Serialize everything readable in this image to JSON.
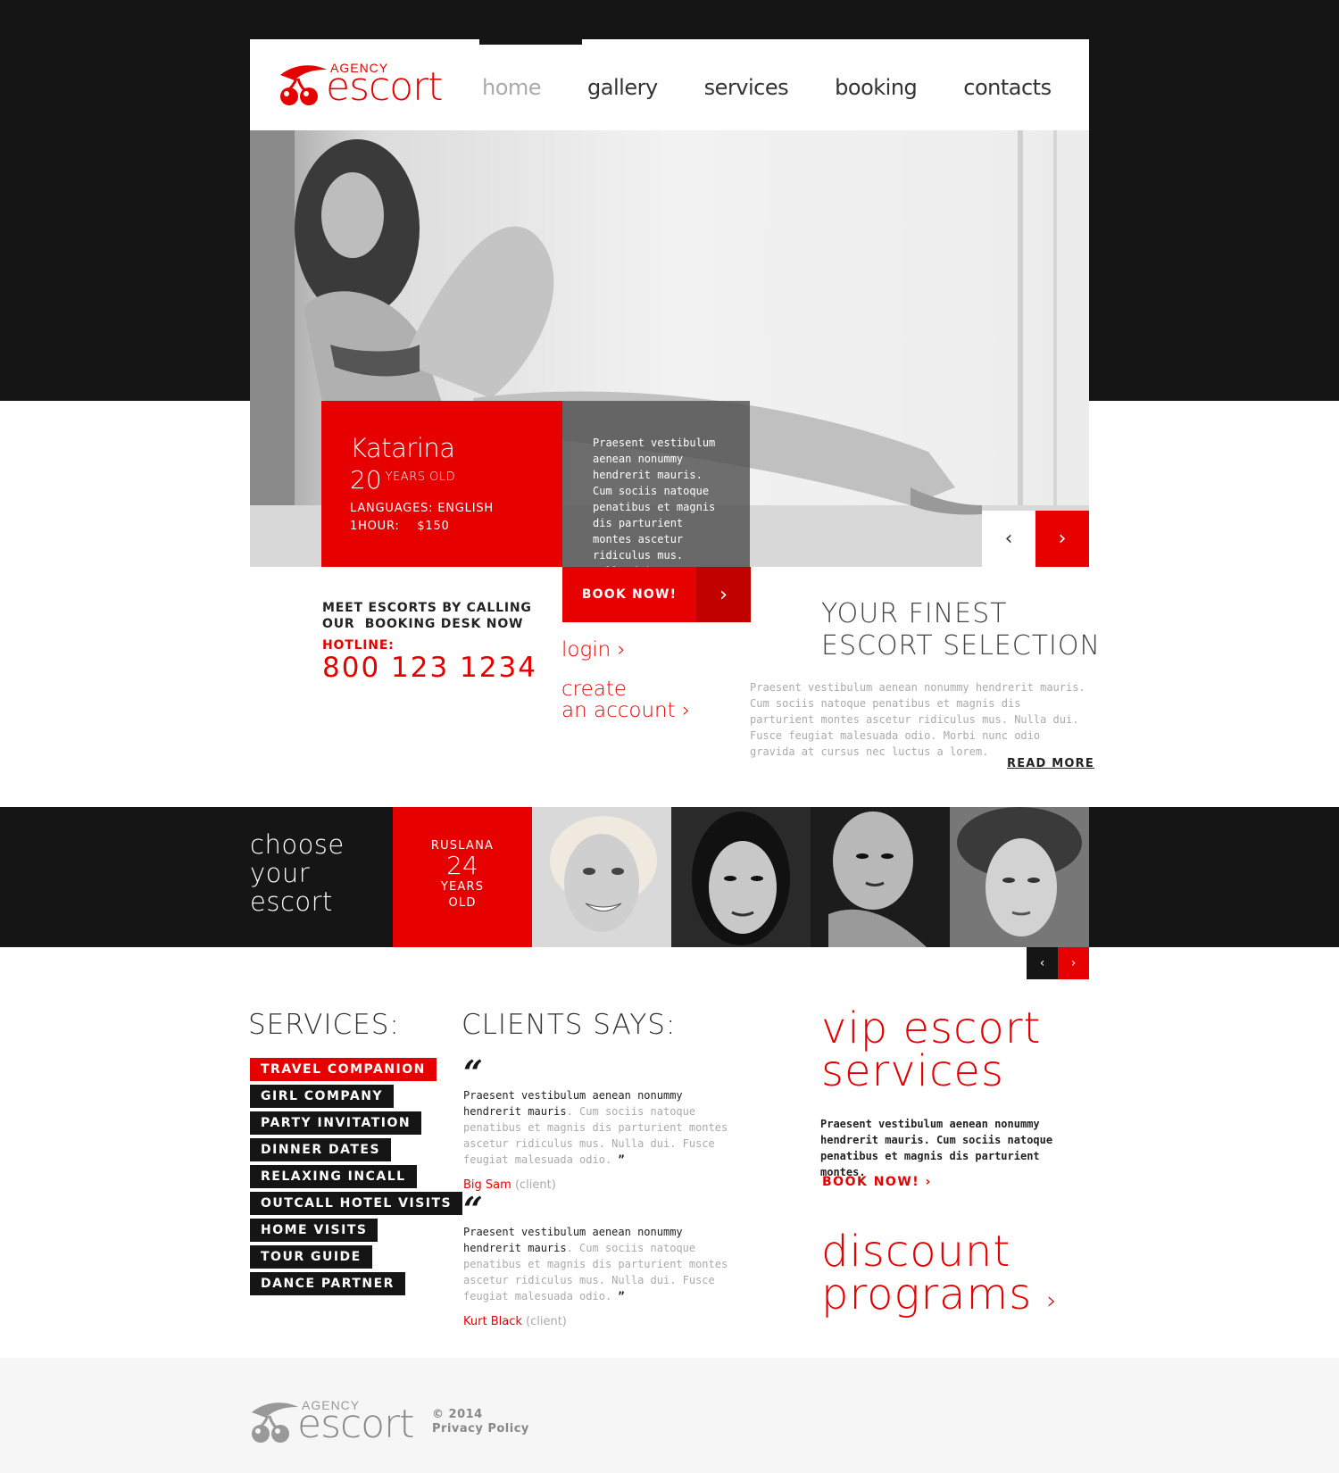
{
  "brand": {
    "agency": "AGENCY",
    "name": "escort"
  },
  "nav": {
    "home": "home",
    "gallery": "gallery",
    "services": "services",
    "booking": "booking",
    "contacts": "contacts"
  },
  "hero": {
    "name": "Katarina",
    "age": "20",
    "age_suffix": "YEARS OLD",
    "languages": "LANGUAGES: ENGLISH",
    "rate": "1HOUR:    $150",
    "description": "Praesent vestibulum aenean nonummy hendrerit mauris. Cum sociis natoque penatibus et magnis dis parturient montes ascetur ridiculus mus. Nulla dui.",
    "prev_icon": "chevron-left-icon",
    "next_icon": "chevron-right-icon"
  },
  "booking": {
    "book_now": "BOOK NOW!",
    "arrow_icon": "chevron-right-icon"
  },
  "contact": {
    "meet_line1": "MEET ESCORTS BY CALLING",
    "meet_line2": "OUR  BOOKING DESK NOW",
    "hotline_label": "HOTLINE:",
    "hotline": "800 123 1234"
  },
  "account": {
    "login": "login",
    "create_line1": "create",
    "create_line2": "an account"
  },
  "finest": {
    "title_line1": "YOUR FINEST",
    "title_line2": "ESCORT SELECTION",
    "text": "Praesent vestibulum aenean nonummy hendrerit mauris. Cum sociis natoque penatibus et magnis dis parturient montes ascetur ridiculus mus. Nulla dui. Fusce feugiat malesuada odio. Morbi nunc odio gravida at cursus nec luctus a lorem.",
    "read_more": "READ MORE"
  },
  "choose": {
    "line1": "choose",
    "line2": "your",
    "line3": "escort",
    "featured_name": "RUSLANA",
    "featured_age": "24",
    "featured_years": "YEARS",
    "featured_old": "OLD"
  },
  "services": {
    "title": "SERVICES:",
    "items": [
      "TRAVEL COMPANION",
      "GIRL COMPANY",
      "PARTY INVITATION",
      "DINNER DATES",
      "RELAXING INCALL",
      "OUTCALL HOTEL VISITS",
      "HOME VISITS",
      "TOUR GUIDE",
      "DANCE PARTNER"
    ]
  },
  "clients": {
    "title": "CLIENTS SAYS:",
    "quotes": [
      {
        "lead": "Praesent vestibulum aenean nonummy hendrerit mauris",
        "rest": ". Cum sociis natoque penatibus et magnis dis parturient montes ascetur ridiculus mus. Nulla dui. Fusce feugiat malesuada odio.",
        "author": "Big Sam",
        "role": "(client)"
      },
      {
        "lead": "Praesent vestibulum aenean nonummy hendrerit mauris",
        "rest": ". Cum sociis natoque penatibus et magnis dis parturient montes ascetur ridiculus mus. Nulla dui. Fusce feugiat malesuada odio.",
        "author": "Kurt Black",
        "role": "(client)"
      }
    ]
  },
  "vip": {
    "title_line1": "vip escort",
    "title_line2": "services",
    "text": "Praesent vestibulum aenean nonummy hendrerit mauris. Cum sociis natoque penatibus et magnis dis parturient montes.",
    "book_now": "BOOK NOW!",
    "discount_line1": "discount",
    "discount_line2": "programs"
  },
  "footer": {
    "copyright": "© 2014",
    "privacy": "Privacy Policy"
  },
  "colors": {
    "accent": "#e60000",
    "dark": "#151515"
  }
}
